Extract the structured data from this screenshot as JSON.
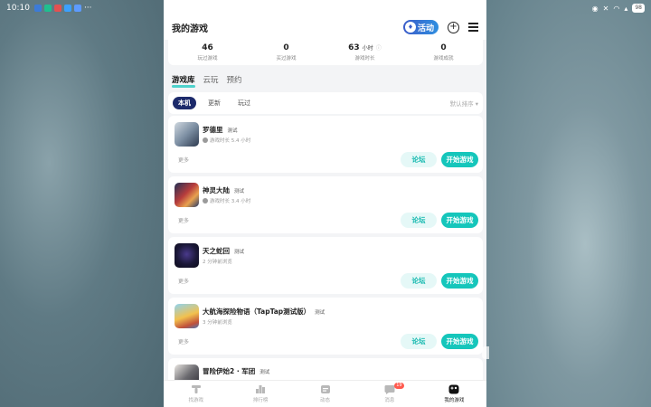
{
  "status_bar": {
    "time": "10:10",
    "battery": "98"
  },
  "app": {
    "title": "我的游戏",
    "activity_badge": "活动"
  },
  "stats": [
    {
      "value": "46",
      "unit": "",
      "label": "玩过游戏"
    },
    {
      "value": "0",
      "unit": "",
      "label": "买过游戏"
    },
    {
      "value": "63",
      "unit": "小时",
      "label": "游戏时长"
    },
    {
      "value": "0",
      "unit": "",
      "label": "游戏成就"
    }
  ],
  "tabs": [
    "游戏库",
    "云玩",
    "预约"
  ],
  "filters": {
    "chips": [
      "本机",
      "更新",
      "玩过"
    ],
    "sort": "默认排序"
  },
  "games": [
    {
      "name": "罗德里",
      "tag": "测试",
      "meta": "游戏时长 5.4 小时",
      "more": "更多",
      "forum": "论坛",
      "play": "开始游戏"
    },
    {
      "name": "神灵大陆",
      "tag": "测试",
      "meta": "游戏时长 3.4 小时",
      "more": "更多",
      "forum": "论坛",
      "play": "开始游戏"
    },
    {
      "name": "天之蛇回",
      "tag": "测试",
      "meta": "2 分钟前浏览",
      "more": "更多",
      "forum": "论坛",
      "play": "开始游戏"
    },
    {
      "name": "大航海探险物语（TapTap测试版）",
      "tag": "测试",
      "meta": "3 分钟前浏览",
      "more": "更多",
      "forum": "论坛",
      "play": "开始游戏"
    },
    {
      "name": "冒险伊始2 · 军团",
      "tag": "测试",
      "meta": "",
      "more": "",
      "forum": "",
      "play": ""
    }
  ],
  "bottom_nav": [
    {
      "label": "找游戏",
      "icon": "tap-icon"
    },
    {
      "label": "排行榜",
      "icon": "ranking-icon"
    },
    {
      "label": "动态",
      "icon": "feed-icon"
    },
    {
      "label": "消息",
      "icon": "message-icon",
      "badge": "19"
    },
    {
      "label": "我的游戏",
      "icon": "my-games-icon"
    }
  ]
}
